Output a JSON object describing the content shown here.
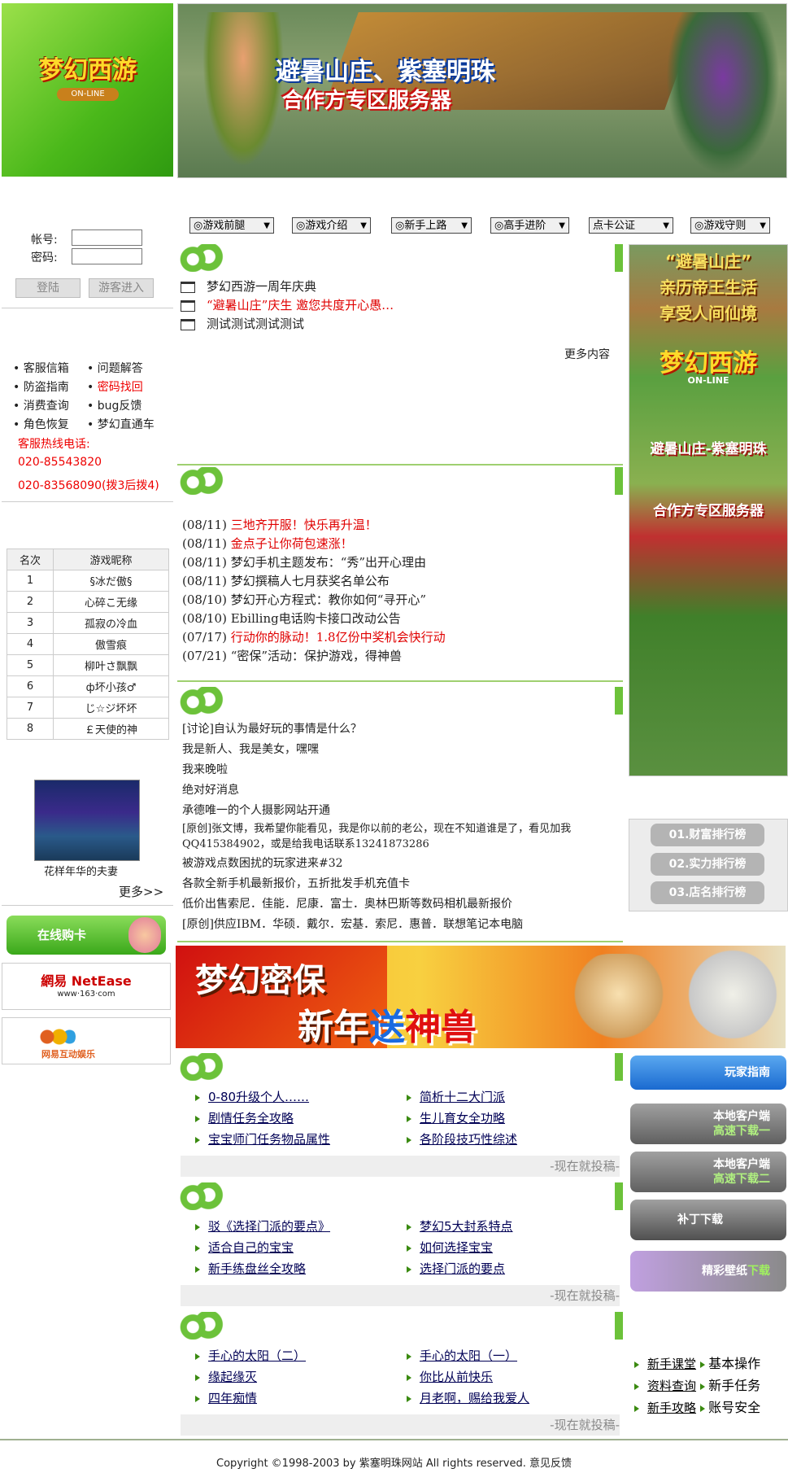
{
  "header": {
    "logo_text": "梦幻西游",
    "logo_sub": "ON-LINE",
    "banner_title": "避暑山庄、紫塞明珠",
    "banner_sub": "合作方专区服务器"
  },
  "nav": [
    "◎游戏前腿",
    "◎游戏介绍",
    "◎新手上路",
    "◎高手进阶",
    "点卡公证",
    "◎游戏守则"
  ],
  "login": {
    "account_label": "帐号:",
    "password_label": "密码:",
    "login_button": "登陆",
    "guest_button": "游客进入"
  },
  "service_links": [
    [
      "客服信箱",
      "问题解答"
    ],
    [
      "防盗指南",
      "密码找回"
    ],
    [
      "消费查询",
      "bug反馈"
    ],
    [
      "角色恢复",
      "梦幻直通车"
    ]
  ],
  "hotline": {
    "label": "客服热线电话:",
    "phone1": "020-85543820",
    "phone2": "020-83568090(拨3后拨4)"
  },
  "rank_table": {
    "headers": [
      "名次",
      "游戏昵称"
    ],
    "rows": [
      [
        "1",
        "§冰だ傲§"
      ],
      [
        "2",
        "心碎こ无缘"
      ],
      [
        "3",
        "孤寂の冷血"
      ],
      [
        "4",
        "傲雪痕"
      ],
      [
        "5",
        "柳叶さ飘飘"
      ],
      [
        "6",
        "ф坏小孩♂"
      ],
      [
        "7",
        "じ☆ジ坏坏"
      ],
      [
        "8",
        "￡天使的神"
      ]
    ]
  },
  "screenshot_caption": "花样年华的夫妻",
  "more_link": "更多>>",
  "left_ads": {
    "buy_card": "在线购卡",
    "netease": "網易 NetEase",
    "netease_url": "www·163·com",
    "netease_games": "网易互动娱乐"
  },
  "announcements": {
    "items": [
      {
        "text": "梦幻西游一周年庆典",
        "color": "#222"
      },
      {
        "text": "“避暑山庄”庆生 邀您共度开心愚…",
        "color": "#e00000"
      },
      {
        "text": "测试测试测试测试",
        "color": "#222"
      }
    ],
    "more": "更多内容"
  },
  "news": [
    {
      "date": "(08/11)",
      "text": "三地齐开服！快乐再升温！",
      "color": "#e00000"
    },
    {
      "date": "(08/11)",
      "text": "金点子让你荷包速涨！",
      "color": "#e00000"
    },
    {
      "date": "(08/11)",
      "text": "梦幻手机主题发布：“秀”出开心理由",
      "color": "#222"
    },
    {
      "date": "(08/11)",
      "text": "梦幻撰稿人七月获奖名单公布",
      "color": "#222"
    },
    {
      "date": "(08/10)",
      "text": "梦幻开心方程式：教你如何“寻开心”",
      "color": "#222"
    },
    {
      "date": "(08/10)",
      "text": "Ebilling电话购卡接口改动公告",
      "color": "#222"
    },
    {
      "date": "(07/17)",
      "text": "行动你的脉动！1.8亿份中奖机会快行动",
      "color": "#e00000"
    },
    {
      "date": "(07/21)",
      "text": "“密保”活动：保护游戏，得神兽",
      "color": "#222"
    }
  ],
  "forum_topics": [
    "[讨论]自认为最好玩的事情是什么？",
    "我是新人、我是美女，嘿嘿",
    "我来晚啦",
    "绝对好消息",
    "承德唯一的个人摄影网站开通",
    "[原创]张文博，我希望你能看见，我是你以前的老公，现在不知道谁是了，看见加我QQ415384902，或是给我电话联系13241873286",
    "被游戏点数困扰的玩家进来#32",
    "各款全新手机最新报价，五折批发手机充值卡",
    "低价出售索尼．佳能．尼康．富士．奥林巴斯等数码相机最新报价",
    "[原创]供应IBM．华硕．戴尔．宏基．索尼．惠普．联想笔记本电脑"
  ],
  "promo_banner": {
    "line1": "梦幻密保",
    "line2_a": "新年",
    "line2_b": "送",
    "line2_c": "神兽"
  },
  "guide_blocks": [
    {
      "col1": [
        "0-80升级个人……",
        "剧情任务全攻略",
        "宝宝师门任务物品属性"
      ],
      "col2": [
        "简析十二大门派",
        "生儿育女全功略",
        "各阶段技巧性综述"
      ],
      "submit": "-现在就投稿-"
    },
    {
      "col1": [
        "驳《选择门派的要点》",
        "适合自己的宝宝",
        "新手练盘丝全攻略"
      ],
      "col2": [
        "梦幻5大封系特点",
        "如何选择宝宝",
        "选择门派的要点"
      ],
      "submit": "-现在就投稿-"
    },
    {
      "col1": [
        "手心的太阳（二）",
        "缘起缘灭",
        "四年痴情"
      ],
      "col2": [
        "手心的太阳（一）",
        "你比从前快乐",
        "月老啊，赐给我爱人"
      ],
      "submit": "-现在就投稿-"
    }
  ],
  "right_ad": {
    "line1": "“避暑山庄”",
    "line2": "亲历帝王生活",
    "line3": "享受人间仙境",
    "logo": "梦幻西游",
    "logo_sub": "ON-LINE",
    "line4": "避暑山庄-紫塞明珠",
    "line5": "合作方专区服务器"
  },
  "rank_buttons": [
    "01.财富排行榜",
    "02.实力排行榜",
    "03.店名排行榜"
  ],
  "right_buttons": {
    "guide": "玩家指南",
    "client1_a": "本地客户端",
    "client1_b": "高速下载一",
    "client2_a": "本地客户端",
    "client2_b": "高速下载二",
    "patch": "补丁下载",
    "wallpaper_a": "精彩壁纸",
    "wallpaper_b": "下载"
  },
  "quick_links": [
    [
      "新手课堂",
      "基本操作"
    ],
    [
      "资料查询",
      "新手任务"
    ],
    [
      "新手攻略",
      "账号安全"
    ]
  ],
  "footer": "Copyright ©1998-2003 by 紫塞明珠网站 All rights reserved. 意见反馈"
}
